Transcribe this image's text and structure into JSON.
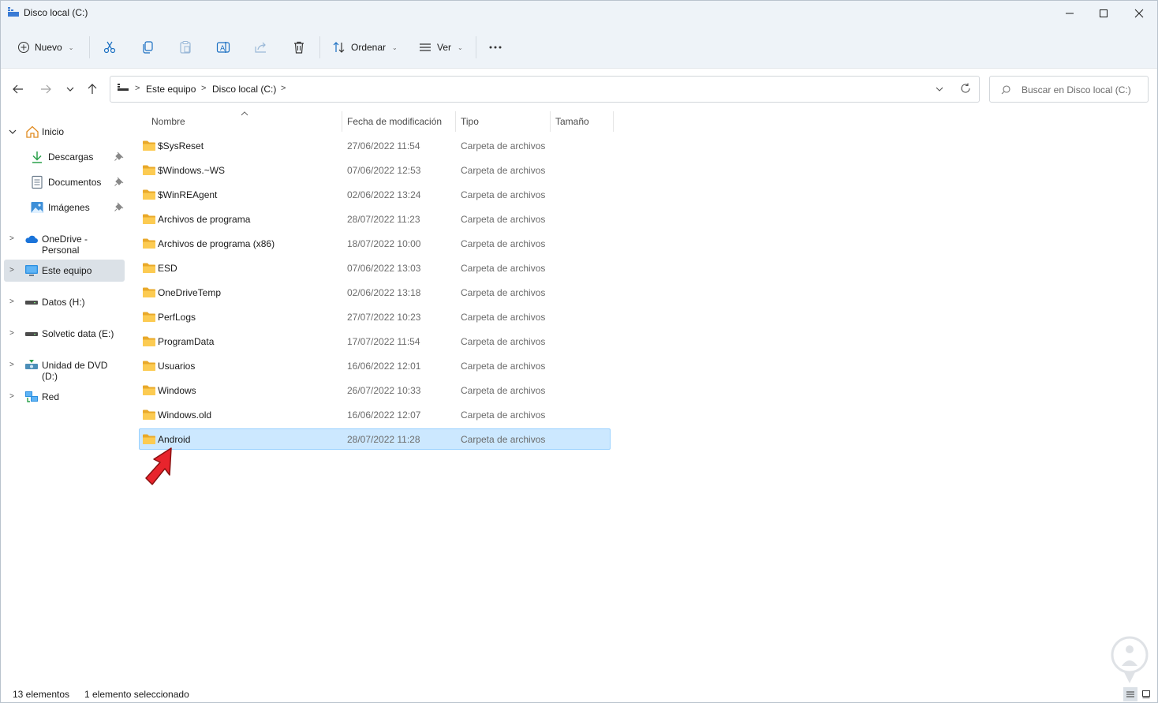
{
  "window": {
    "title": "Disco local (C:)",
    "minimize_icon": "minimize-icon",
    "maximize_icon": "maximize-icon",
    "close_icon": "close-icon"
  },
  "toolbar": {
    "new_label": "Nuevo",
    "sort_label": "Ordenar",
    "view_label": "Ver",
    "icons": [
      "cut-icon",
      "copy-icon",
      "paste-icon",
      "rename-icon",
      "share-icon",
      "delete-icon",
      "more-icon"
    ]
  },
  "navigation": {
    "breadcrumbs": [
      "Este equipo",
      "Disco local (C:)"
    ],
    "search_placeholder": "Buscar en Disco local (C:)"
  },
  "sidebar": {
    "items": [
      {
        "label": "Inicio",
        "icon": "home-icon",
        "expanded": true
      },
      {
        "label": "Descargas",
        "icon": "download-icon",
        "pinned": true
      },
      {
        "label": "Documentos",
        "icon": "document-icon",
        "pinned": true
      },
      {
        "label": "Imágenes",
        "icon": "image-icon",
        "pinned": true
      },
      {
        "label": "OneDrive - Personal",
        "icon": "cloud-icon"
      },
      {
        "label": "Este equipo",
        "icon": "computer-icon",
        "selected": true
      },
      {
        "label": "Datos (H:)",
        "icon": "drive-icon"
      },
      {
        "label": "Solvetic data (E:)",
        "icon": "drive-icon"
      },
      {
        "label": "Unidad de DVD (D:)",
        "icon": "dvd-icon"
      },
      {
        "label": "Red",
        "icon": "network-icon"
      }
    ]
  },
  "file_list": {
    "columns": [
      "Nombre",
      "Fecha de modificación",
      "Tipo",
      "Tamaño"
    ],
    "rows": [
      {
        "name": "$SysReset",
        "date": "27/06/2022 11:54",
        "type": "Carpeta de archivos"
      },
      {
        "name": "$Windows.~WS",
        "date": "07/06/2022 12:53",
        "type": "Carpeta de archivos"
      },
      {
        "name": "$WinREAgent",
        "date": "02/06/2022 13:24",
        "type": "Carpeta de archivos"
      },
      {
        "name": "Archivos de programa",
        "date": "28/07/2022 11:23",
        "type": "Carpeta de archivos"
      },
      {
        "name": "Archivos de programa (x86)",
        "date": "18/07/2022 10:00",
        "type": "Carpeta de archivos"
      },
      {
        "name": "ESD",
        "date": "07/06/2022 13:03",
        "type": "Carpeta de archivos"
      },
      {
        "name": "OneDriveTemp",
        "date": "02/06/2022 13:18",
        "type": "Carpeta de archivos"
      },
      {
        "name": "PerfLogs",
        "date": "27/07/2022 10:23",
        "type": "Carpeta de archivos"
      },
      {
        "name": "ProgramData",
        "date": "17/07/2022 11:54",
        "type": "Carpeta de archivos"
      },
      {
        "name": "Usuarios",
        "date": "16/06/2022 12:01",
        "type": "Carpeta de archivos"
      },
      {
        "name": "Windows",
        "date": "26/07/2022 10:33",
        "type": "Carpeta de archivos"
      },
      {
        "name": "Windows.old",
        "date": "16/06/2022 12:07",
        "type": "Carpeta de archivos"
      },
      {
        "name": "Android",
        "date": "28/07/2022 11:28",
        "type": "Carpeta de archivos",
        "selected": true
      }
    ]
  },
  "status": {
    "item_count": "13 elementos",
    "selection": "1 elemento seleccionado"
  },
  "colors": {
    "accent": "#0067c0",
    "selection_bg": "#cce8ff",
    "selection_border": "#99d1ff",
    "folder": "#f8c24a",
    "arrow": "#e8242c"
  }
}
